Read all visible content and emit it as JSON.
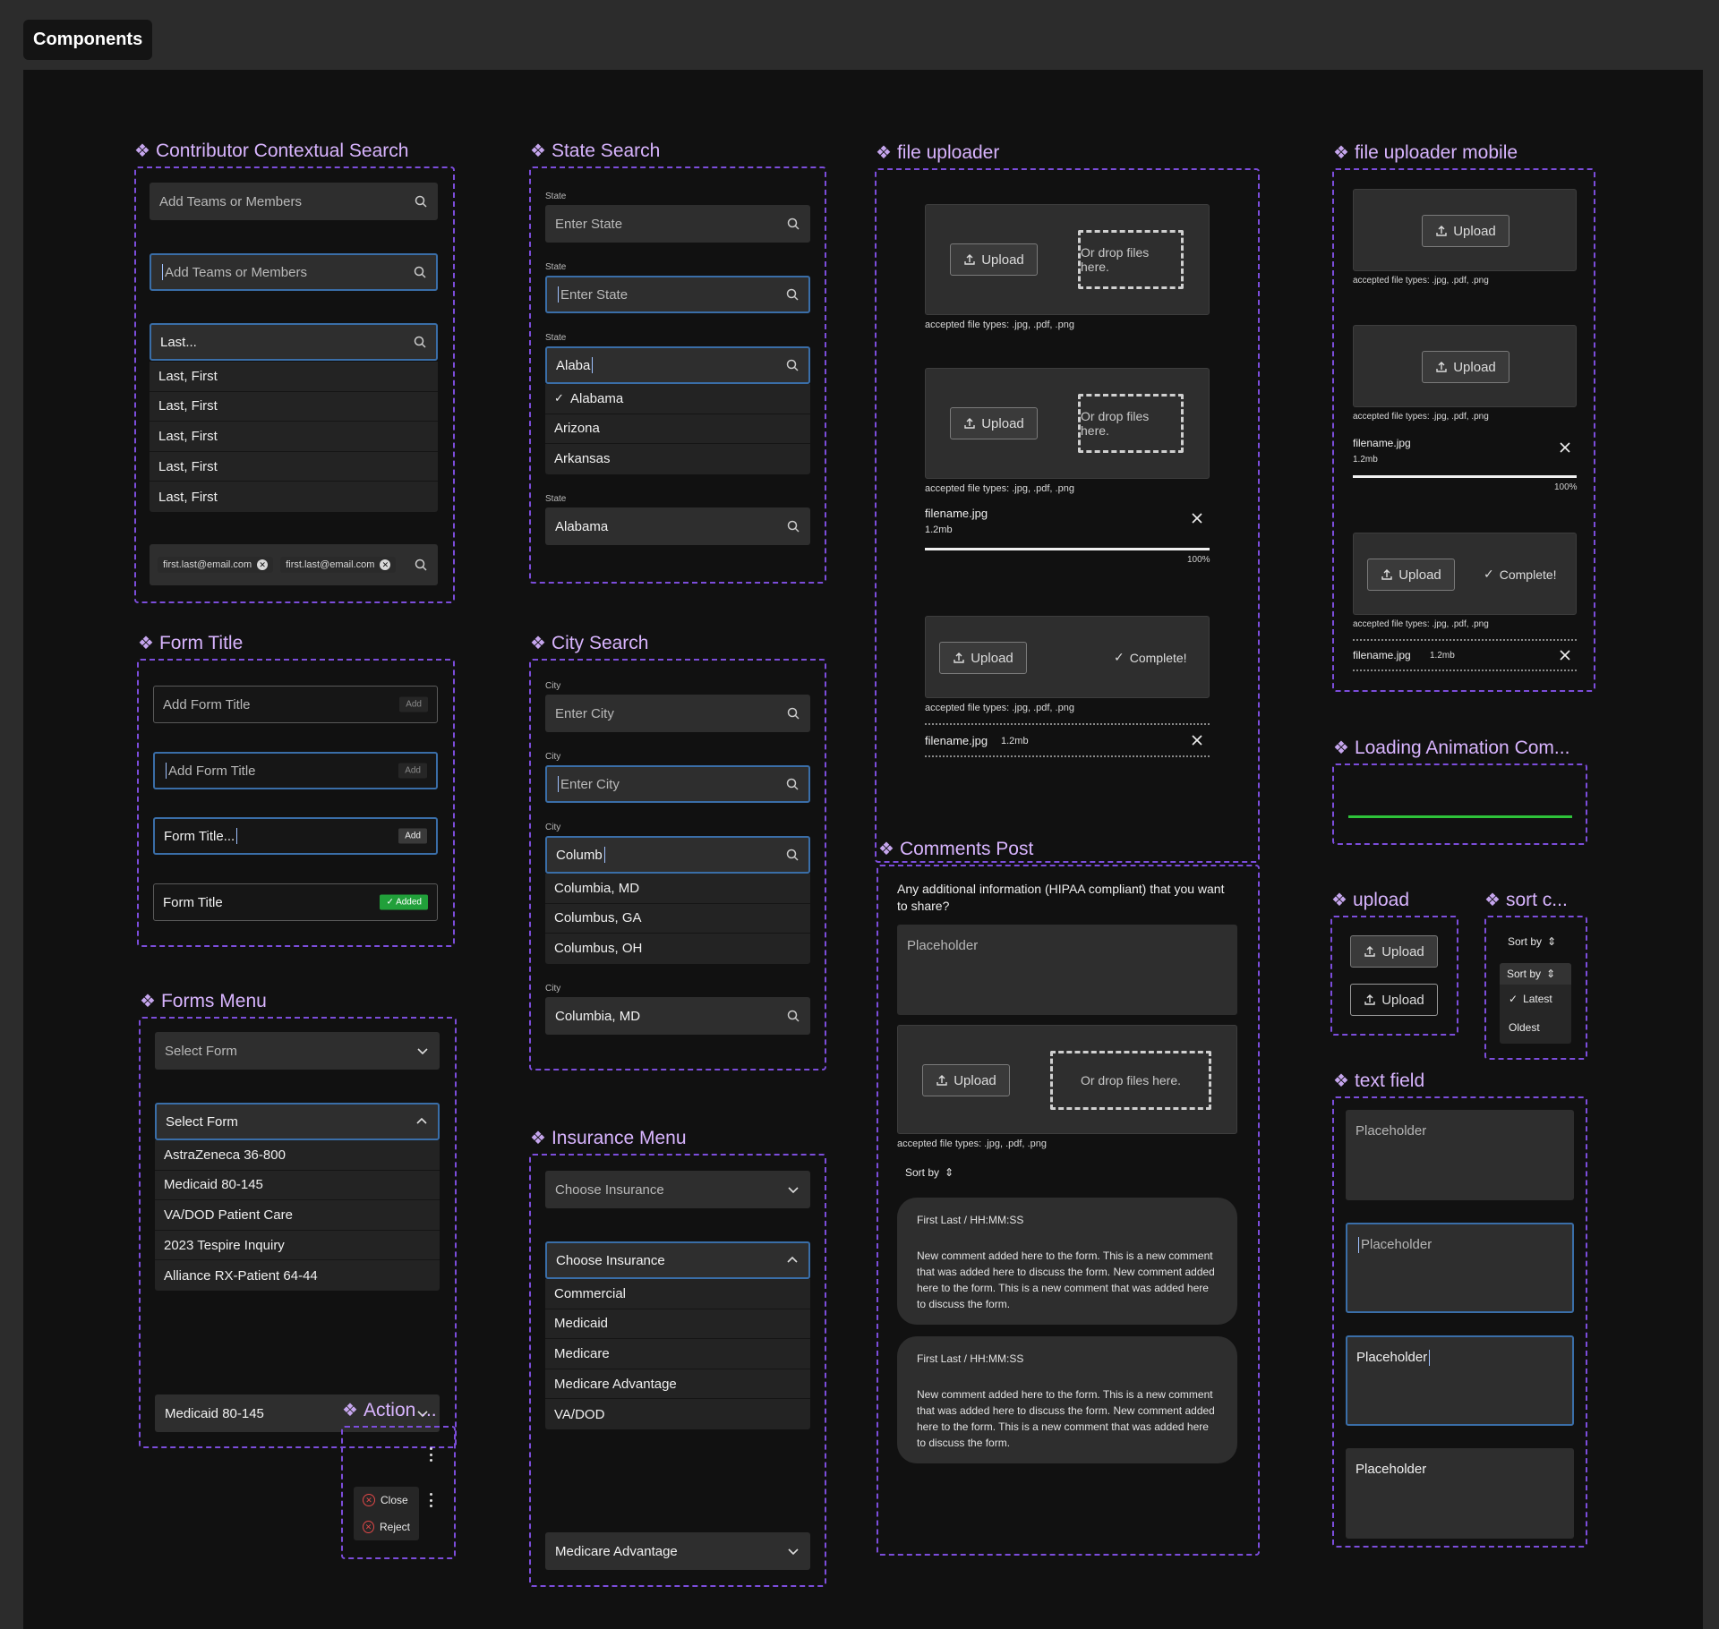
{
  "page_tab": "Components",
  "sections": {
    "contrib": {
      "title": "Contributor Contextual Search",
      "placeholder": "Add Teams or Members",
      "typed": "Last...",
      "results": [
        "Last, First",
        "Last, First",
        "Last, First",
        "Last, First",
        "Last, First"
      ],
      "chips": [
        "first.last@email.com",
        "first.last@email.com"
      ]
    },
    "state": {
      "title": "State Search",
      "label": "State",
      "placeholder": "Enter State",
      "typed": "Alaba",
      "options": [
        "Alabama",
        "Arizona",
        "Arkansas"
      ],
      "selected": "Alabama"
    },
    "city": {
      "title": "City Search",
      "label": "City",
      "placeholder": "Enter City",
      "typed": "Columb",
      "options": [
        "Columbia, MD",
        "Columbus, GA",
        "Columbus, OH"
      ],
      "selected": "Columbia, MD"
    },
    "form_title": {
      "title": "Form Title",
      "placeholder": "Add Form Title",
      "typed": "Form Title...",
      "filled": "Form Title",
      "add_label": "Add",
      "added_label": "Added"
    },
    "forms_menu": {
      "title": "Forms Menu",
      "placeholder": "Select Form",
      "options": [
        "AstraZeneca 36-800",
        "Medicaid 80-145",
        "VA/DOD Patient Care",
        "2023 Tespire Inquiry",
        "Alliance RX-Patient 64-44"
      ],
      "selected": "Medicaid 80-145"
    },
    "insurance": {
      "title": "Insurance Menu",
      "placeholder": "Choose Insurance",
      "options": [
        "Commercial",
        "Medicaid",
        "Medicare",
        "Medicare Advantage",
        "VA/DOD"
      ],
      "selected": "Medicare Advantage"
    },
    "action": {
      "title": "Action ...",
      "items": [
        "Close",
        "Reject"
      ]
    },
    "uploader": {
      "title": "file uploader",
      "upload_label": "Upload",
      "drop_label": "Or drop files here.",
      "accepted": "accepted file types: .jpg, .pdf, .png",
      "file_name": "filename.jpg",
      "file_size": "1.2mb",
      "progress_label": "100%",
      "progress": 1.0,
      "complete_label": "Complete!"
    },
    "uploader_mobile": {
      "title": "file uploader mobile"
    },
    "loading": {
      "title": "Loading Animation Com...",
      "bar_color": "#2ec43a"
    },
    "comments": {
      "title": "Comments Post",
      "question": "Any additional information (HIPAA compliant) that you want to share?",
      "placeholder": "Placeholder",
      "sort_label": "Sort by",
      "posts": [
        {
          "meta": "First Last  / HH:MM:SS",
          "body": "New comment added here to the form. This is a new comment that was added here to discuss the form. New comment added here to the form. This is a new comment that was added here to discuss the form."
        },
        {
          "meta": "First Last / HH:MM:SS",
          "body": "New comment added here to the form. This is a new comment that was added here to discuss the form. New comment added here to the form. This is a new comment that was added here to discuss the form."
        }
      ]
    },
    "upload": {
      "title": "upload",
      "label": "Upload"
    },
    "sort": {
      "title": "sort c...",
      "label": "Sort by",
      "options": [
        "Latest",
        "Oldest"
      ]
    },
    "text_field": {
      "title": "text field",
      "placeholder": "Placeholder"
    }
  },
  "colors": {
    "accent": "#d8b4fe",
    "focus": "#3a6ea8",
    "success": "#21a03a",
    "danger": "#e04848"
  }
}
